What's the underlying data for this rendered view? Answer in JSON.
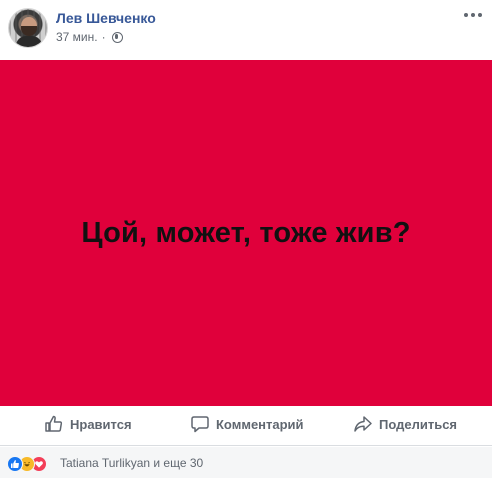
{
  "post": {
    "author_name": "Лев Шевченко",
    "time": "37 мин.",
    "separator": "·",
    "privacy_icon": "globe-icon",
    "menu_icon": "more-dots-icon"
  },
  "banner": {
    "text": "Цой, может, тоже жив?",
    "background_color": "#e0003b",
    "text_color": "#111111"
  },
  "actions": {
    "like_label": "Нравится",
    "comment_label": "Комментарий",
    "share_label": "Поделиться"
  },
  "reactions": {
    "icons": [
      "like-reaction-icon",
      "haha-reaction-icon",
      "love-reaction-icon"
    ],
    "summary": "Tatiana Turlikyan и еще 30"
  },
  "colors": {
    "accent_link": "#385898",
    "secondary_text": "#606770"
  }
}
